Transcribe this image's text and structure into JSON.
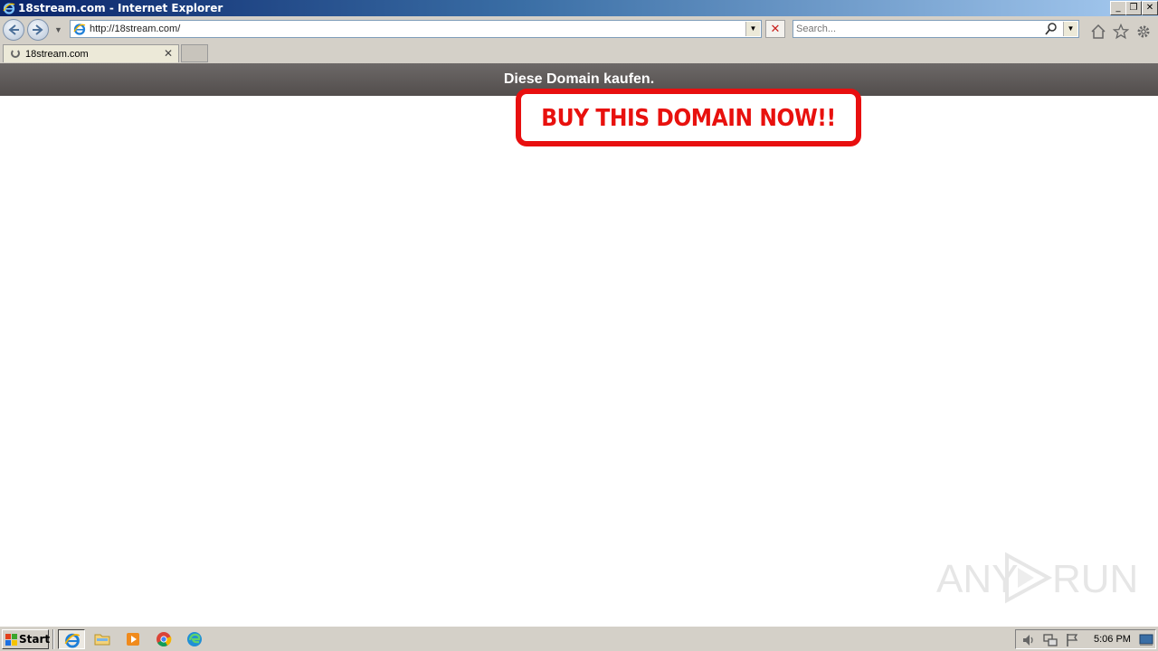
{
  "window": {
    "title": "18stream.com - Internet Explorer",
    "minimize_glyph": "_",
    "restore_glyph": "❐",
    "close_glyph": "✕"
  },
  "navbar": {
    "address_url": "http://18stream.com/",
    "search_placeholder": "Search...",
    "stop_glyph": "✕"
  },
  "tabs": [
    {
      "label": "18stream.com",
      "loading": true,
      "close_glyph": "✕"
    }
  ],
  "page": {
    "banner_text": "Diese Domain kaufen.",
    "buy_text": "BUY THIS DOMAIN NOW!!",
    "accent_color": "#e8110e",
    "banner_color": "#5e5a59"
  },
  "watermark": {
    "left": "ANY",
    "right": "RUN"
  },
  "taskbar": {
    "start_label": "Start",
    "apps": [
      "internet-explorer-icon",
      "folder-icon",
      "media-player-icon",
      "chrome-icon",
      "edge-icon"
    ],
    "clock": "5:06 PM"
  }
}
